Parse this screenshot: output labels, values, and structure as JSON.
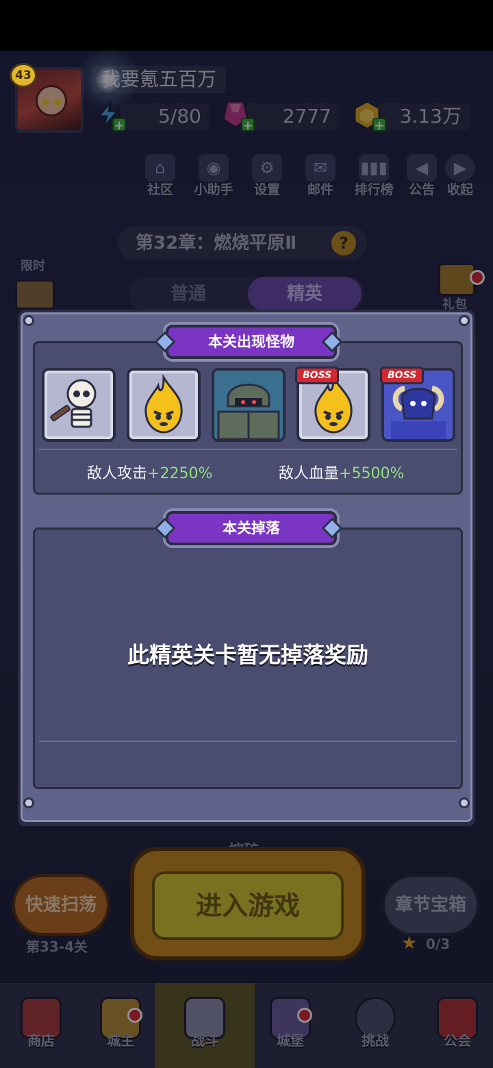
{
  "player": {
    "level": "43",
    "name": "我要氪五百万"
  },
  "resources": {
    "energy": "5/80",
    "gems": "2777",
    "gold": "3.13万"
  },
  "top_menu": [
    {
      "id": "community",
      "label": "社区",
      "icon": "community-icon"
    },
    {
      "id": "assistant",
      "label": "小助手",
      "icon": "robot-icon"
    },
    {
      "id": "settings",
      "label": "设置",
      "icon": "gear-icon"
    },
    {
      "id": "mail",
      "label": "邮件",
      "icon": "mail-icon"
    },
    {
      "id": "ranking",
      "label": "排行榜",
      "icon": "bar-chart-icon"
    },
    {
      "id": "announcement",
      "label": "公告",
      "icon": "megaphone-icon"
    },
    {
      "id": "collapse",
      "label": "收起",
      "icon": "play-icon"
    }
  ],
  "chapter": {
    "title": "第32章：燃烧平原Ⅱ"
  },
  "mode_tabs": {
    "normal": "普通",
    "elite": "精英"
  },
  "side_left": {
    "limited": "限时"
  },
  "side_right": {
    "gift": "礼包"
  },
  "modal": {
    "monsters_title": "本关出现怪物",
    "monsters": [
      {
        "name": "skeleton-warrior",
        "boss": false
      },
      {
        "name": "fire-spirit",
        "boss": false
      },
      {
        "name": "armored-knight",
        "boss": false
      },
      {
        "name": "fire-spirit",
        "boss": true
      },
      {
        "name": "horned-demon",
        "boss": true
      }
    ],
    "boss_label": "BOSS",
    "enemy_attack_label": "敌人攻击",
    "enemy_attack_value": "+2250%",
    "enemy_hp_label": "敌人血量",
    "enemy_hp_value": "+5500%",
    "drops_title": "本关掉落",
    "no_drops_text": "此精英关卡暂无掉落奖励"
  },
  "actions": {
    "mining": "挖矿",
    "quick_sweep": "快速扫荡",
    "sweep_stage": "第33-4关",
    "enter_game": "进入游戏",
    "chapter_chest": "章节宝箱",
    "chest_progress": "0/3"
  },
  "bottom_nav": [
    {
      "id": "shop",
      "label": "商店",
      "dot": false
    },
    {
      "id": "lord",
      "label": "城主",
      "dot": true
    },
    {
      "id": "battle",
      "label": "战斗",
      "dot": false,
      "active": true
    },
    {
      "id": "castle",
      "label": "城堡",
      "dot": true
    },
    {
      "id": "challenge",
      "label": "挑战",
      "dot": false
    },
    {
      "id": "guild",
      "label": "公会",
      "dot": false
    }
  ],
  "colors": {
    "accent_purple": "#7b35c4",
    "bonus_green": "#8ee07b",
    "boss_red": "#d2282f"
  }
}
